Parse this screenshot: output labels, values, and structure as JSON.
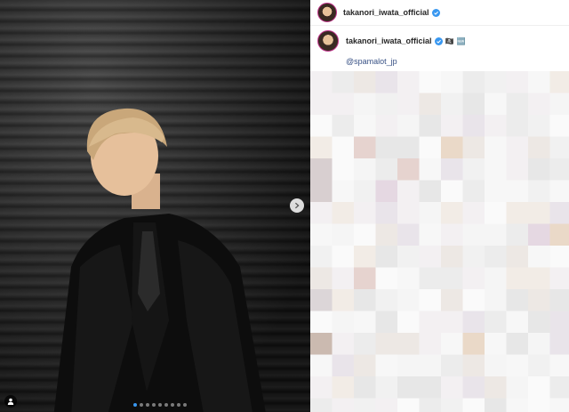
{
  "post": {
    "image_alt": "Person in a black patterned suit against a dark roller shutter",
    "carousel": {
      "count": 9,
      "active": 0
    }
  },
  "header": {
    "username": "takanori_iwata_official",
    "verified": true,
    "more_label": "•••"
  },
  "caption": {
    "username": "takanori_iwata_official",
    "emojis": [
      "🏴‍☠️",
      "🆕"
    ],
    "mention": "@spamalot_jp"
  },
  "colors": {
    "verified_badge": "#3897f0",
    "mention": "#385185",
    "avatar_ring": "#c1358c",
    "active_dot": "#3897f0"
  },
  "icons": {
    "next": "chevron-right-icon",
    "tag": "person-tag-icon",
    "verified": "verified-badge-icon"
  }
}
